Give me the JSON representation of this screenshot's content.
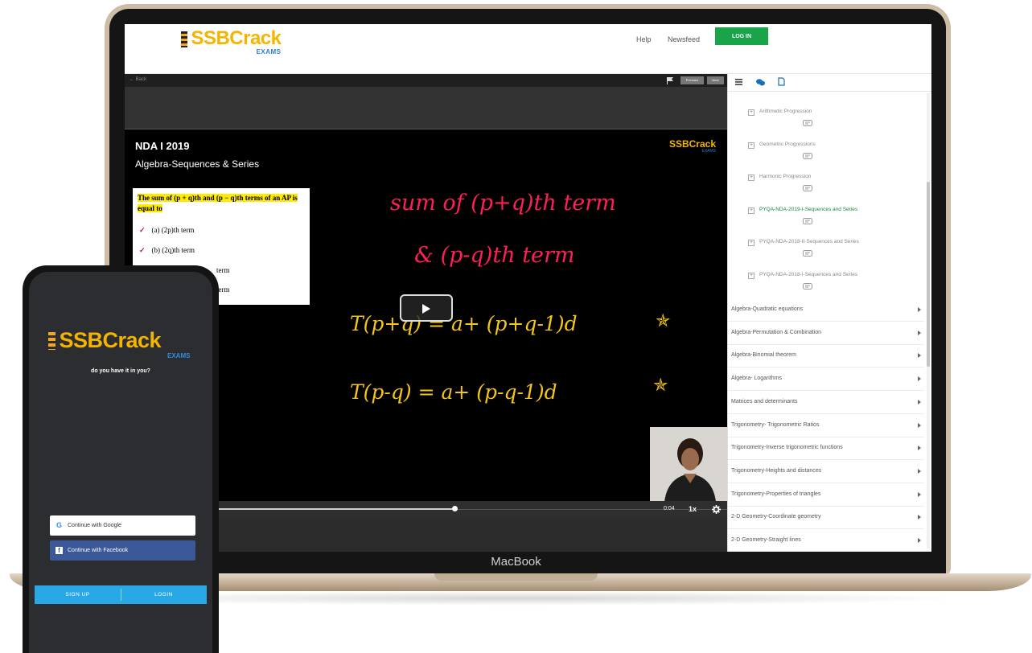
{
  "laptop": {
    "brand_label": "MacBook"
  },
  "site": {
    "logo_text": "SSBCrack",
    "logo_sub": "EXAMS",
    "nav": {
      "help": "Help",
      "newsfeed": "Newsfeed",
      "login": "LOG IN"
    }
  },
  "player": {
    "back_label": "← Back",
    "previous_label": "Previous",
    "next_label": "Next",
    "video_title": "NDA I 2019",
    "video_subtitle": "Algebra-Sequences & Series",
    "watermark_text": "SSBCrack",
    "watermark_sub": "EXAMS",
    "question": {
      "text": "The sum of (p + q)th and (p − q)th terms of an AP is equal to",
      "option_a": "(a)  (2p)th term",
      "option_b": "(b)  (2q)th term",
      "option_c": "term",
      "option_d": "term"
    },
    "board": {
      "line1": "sum of (p+q)th term",
      "line2": "& (p-q)th term",
      "line3": "T(p+q) = a+ (p+q-1)d",
      "line4": "T(p-q) = a+ (p-q-1)d"
    },
    "progress_fraction": 0.55,
    "time_label": "0:04",
    "speed_label": "1x"
  },
  "sidebar": {
    "sub_items": [
      {
        "label": "Arithmetic Progression",
        "active": false
      },
      {
        "label": "Geometric Progressions",
        "active": false
      },
      {
        "label": "Harmonic Progression",
        "active": false
      },
      {
        "label": "PYQA-NDA-2019-I-Sequences and Series",
        "active": true
      },
      {
        "label": "PYQA-NDA-2018-II-Sequences and Series",
        "active": false
      },
      {
        "label": "PYQA-NDA-2018-I-Sequences and Series",
        "active": false
      }
    ],
    "chapters": [
      "Algebra-Quadratic equations",
      "Algebra-Permutation & Combination",
      "Algebra-Binomial theorem",
      "Algebra- Logarithms",
      "Matrices and determinants",
      "Trigonometry- Trigonometric Ratios",
      "Trigonometry-Inverse trigonometric functions",
      "Trigonometry-Heights and distances",
      "Trigonometry-Properties of triangles",
      "2-D Geometry-Coordinate geometry",
      "2-D Geometry-Straight lines"
    ]
  },
  "phone": {
    "logo_text": "SSBCrack",
    "logo_sub": "EXAMS",
    "tagline": "do you have it in you?",
    "google_label": "Continue with Google",
    "facebook_label": "Continue with Facebook",
    "signup_label": "SIGN UP",
    "login_label": "LOGIN"
  },
  "colors": {
    "brand_yellow": "#f4b400",
    "brand_blue": "#2a7fd4",
    "login_green": "#1aa44a",
    "active_green": "#1a8a3a",
    "ink_pink": "#ff1f57",
    "ink_yellow": "#f5c518",
    "facebook_blue": "#3b5998",
    "auth_blue": "#29a8e8"
  }
}
